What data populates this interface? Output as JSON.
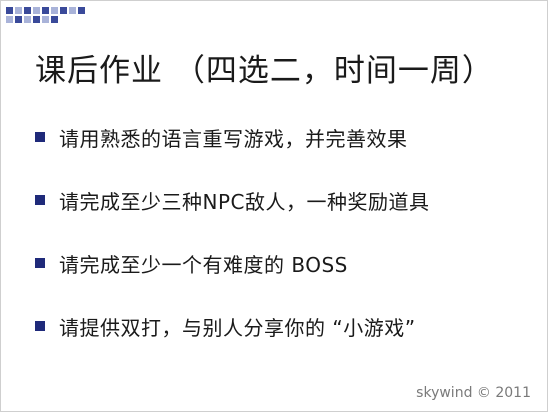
{
  "slide": {
    "title": "课后作业 （四选二，时间一周）",
    "bullets": [
      {
        "text": "请用熟悉的语言重写游戏，并完善效果"
      },
      {
        "text": "请完成至少三种NPC敌人，一种奖励道具"
      },
      {
        "text": "请完成至少一个有难度的 BOSS"
      },
      {
        "text": "请提供双打，与别人分享你的 “小游戏”"
      }
    ],
    "watermark": "skywind © 2011"
  },
  "colors": {
    "bullet": "#1f2a7a",
    "decor_primary": "#3a4a9a",
    "decor_secondary": "#a9b3d9",
    "text": "#1a1a1a"
  },
  "icons": {
    "decor": "grid-squares-decoration",
    "bullet": "square-bullet-icon"
  }
}
